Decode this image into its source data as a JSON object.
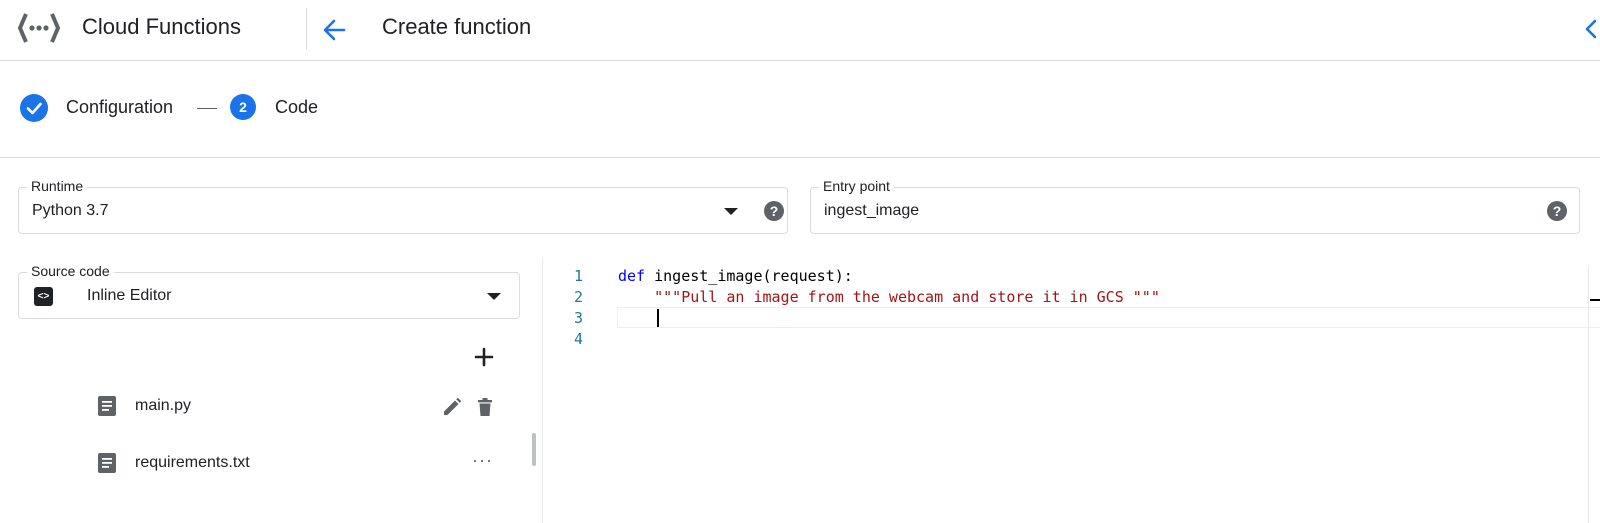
{
  "header": {
    "app_title": "Cloud Functions",
    "page_title": "Create function"
  },
  "stepper": {
    "step1_label": "Configuration",
    "step2_number": "2",
    "step2_label": "Code"
  },
  "runtime": {
    "label": "Runtime",
    "value": "Python 3.7"
  },
  "entry_point": {
    "label": "Entry point",
    "value": "ingest_image"
  },
  "source_code": {
    "label": "Source code",
    "value": "Inline Editor"
  },
  "files": [
    {
      "name": "main.py"
    },
    {
      "name": "requirements.txt"
    }
  ],
  "editor": {
    "line_numbers": [
      "1",
      "2",
      "3",
      "4"
    ],
    "line1_keyword": "def",
    "line1_rest": " ingest_image(request):",
    "line2_indent": "    ",
    "line2_docstring": "\"\"\"Pull an image from the webcam and store it in GCS \"\"\""
  },
  "icons": {
    "help": "?",
    "more": "···",
    "editor_badge": "<>"
  },
  "colors": {
    "accent": "#1a73e8",
    "keyword": "#0000ff",
    "string": "#a31515",
    "line_number": "#237893"
  }
}
